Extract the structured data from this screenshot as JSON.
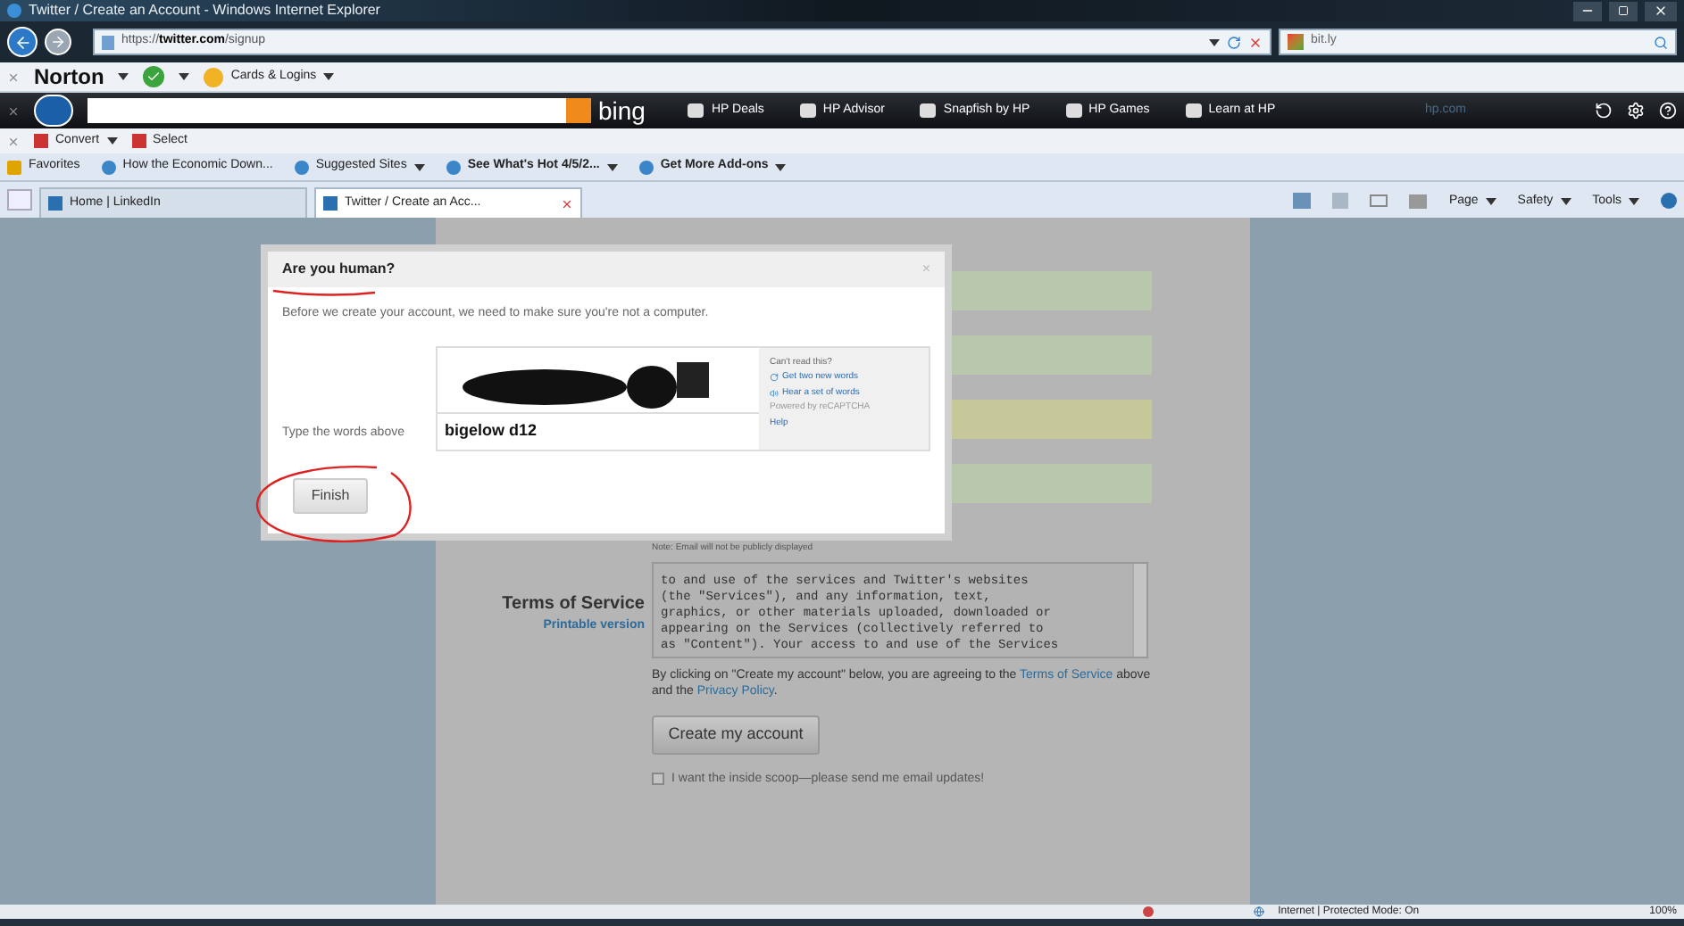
{
  "window": {
    "title": "Twitter / Create an Account - Windows Internet Explorer"
  },
  "address_bar": {
    "url_prefix": "https://",
    "url_host": "twitter.com",
    "url_path": "/signup",
    "search_value": "bit.ly"
  },
  "norton_toolbar": {
    "brand": "Norton",
    "items": [
      "Cards & Logins"
    ]
  },
  "hp_toolbar": {
    "search_button": "bing",
    "links": [
      "HP Deals",
      "HP Advisor",
      "Snapfish by HP",
      "HP Games",
      "Learn at HP"
    ],
    "site": "hp.com"
  },
  "tools_toolbar": {
    "items": [
      "Convert",
      "Select"
    ]
  },
  "favorites_bar": {
    "label": "Favorites",
    "items": [
      {
        "label": "How the Economic Down...",
        "bold": false,
        "menu": false
      },
      {
        "label": "Suggested Sites",
        "bold": false,
        "menu": true
      },
      {
        "label": "See What's Hot 4/5/2...",
        "bold": true,
        "menu": true
      },
      {
        "label": "Get More Add-ons",
        "bold": true,
        "menu": true
      }
    ]
  },
  "tabs": [
    {
      "label": "Home | LinkedIn",
      "selected": false
    },
    {
      "label": "Twitter / Create an Acc...",
      "selected": true
    }
  ],
  "command_bar": [
    "Page",
    "Safety",
    "Tools"
  ],
  "signup_form": {
    "fields": [
      {
        "color": "#b9c8ac"
      },
      {
        "color": "#b9c8ac"
      },
      {
        "color": "#c5c99a"
      },
      {
        "color": "#b9c8ac"
      }
    ],
    "note": "Note: Email will not be publicly displayed",
    "terms_label": "Terms of Service",
    "printable_link": "Printable version",
    "terms_lines": [
      "to and use of the services and Twitter's websites",
      "(the \"Services\"), and any information, text,",
      "graphics, or other materials uploaded, downloaded or",
      "appearing on the Services (collectively referred to",
      "as \"Content\"). Your access to and use of the Services"
    ],
    "agreement_before": "By clicking on \"Create my account\" below, you are agreeing to the",
    "terms_link": "Terms of Service",
    "agreement_middle": "above and the",
    "privacy_link": "Privacy Policy",
    "agreement_end": ".",
    "create_button": "Create my account",
    "updates_checkbox": {
      "label": "I want the inside scoop—please send me email updates!",
      "checked": false
    }
  },
  "dialog": {
    "title": "Are you human?",
    "close": "×",
    "message": "Before we create your account, we need to make sure you're not a computer.",
    "captcha_label": "Type the words above",
    "captcha_value": "bigelow d12",
    "captcha_help": {
      "heading": "Can't read this?",
      "links": [
        "Get two new words",
        "Hear a set of words"
      ],
      "powered_by": "Powered by reCAPTCHA",
      "help": "Help"
    },
    "finish_button": "Finish"
  },
  "status_bar": {
    "zone": "Internet | Protected Mode: On",
    "zoom": "100%"
  }
}
